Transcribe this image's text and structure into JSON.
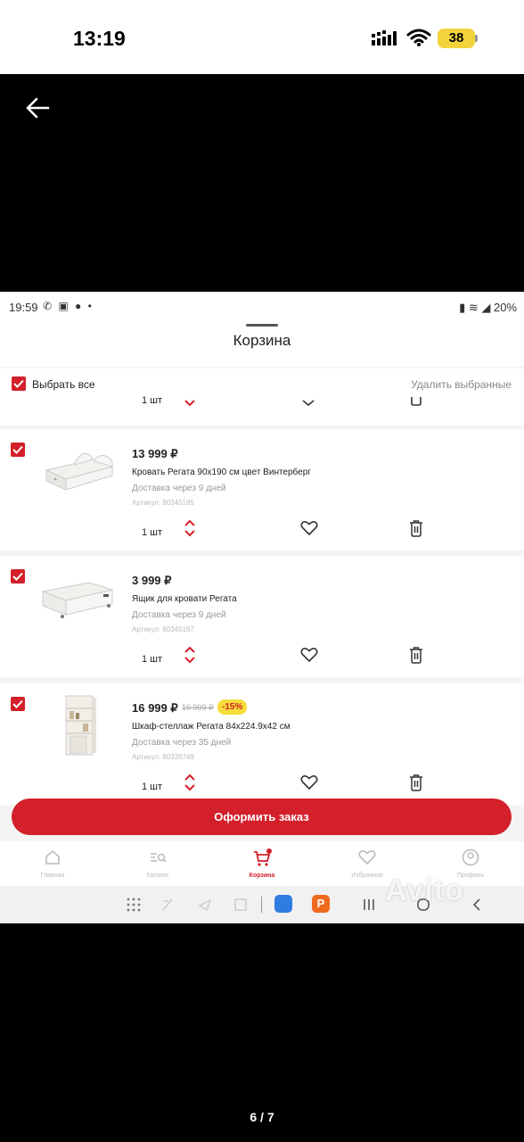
{
  "outer_status": {
    "time": "13:19",
    "battery": "38"
  },
  "inner_status": {
    "time": "19:59",
    "battery": "20%"
  },
  "header": {
    "title": "Корзина"
  },
  "select_bar": {
    "select_all": "Выбрать все",
    "delete_selected": "Удалить выбранные"
  },
  "partial_row": {
    "qty": "1 шт"
  },
  "items": [
    {
      "price": "13 999 ₽",
      "name": "Кровать Регата 90х190 см цвет Винтерберг",
      "delivery": "Доставка через  9 дней",
      "article": "Артикул: 80345185",
      "qty": "1 шт"
    },
    {
      "price": "3 999 ₽",
      "name": "Ящик для кровати Регата",
      "delivery": "Доставка через  9 дней",
      "article": "Артикул: 80345197",
      "qty": "1 шт"
    },
    {
      "price": "16 999 ₽",
      "old_price": "19 999 ₽",
      "discount": "-15%",
      "name": "Шкаф-стеллаж Регата 84х224.9х42 см",
      "delivery": "Доставка через 35 дней",
      "article": "Артикул: 80339749",
      "qty": "1 шт"
    }
  ],
  "order_button": "Оформить заказ",
  "nav": [
    {
      "label": "Главная",
      "icon": "home-icon"
    },
    {
      "label": "Каталог",
      "icon": "catalog-icon"
    },
    {
      "label": "Корзина",
      "icon": "cart-icon",
      "badge": "4"
    },
    {
      "label": "Избранное",
      "icon": "heart-icon"
    },
    {
      "label": "Профиль",
      "icon": "profile-icon"
    }
  ],
  "watermark": "Avito",
  "page_indicator": "6 / 7",
  "colors": {
    "accent": "#d3202a",
    "discount_bg": "#f5dd3a",
    "battery": "#f2d33c"
  }
}
